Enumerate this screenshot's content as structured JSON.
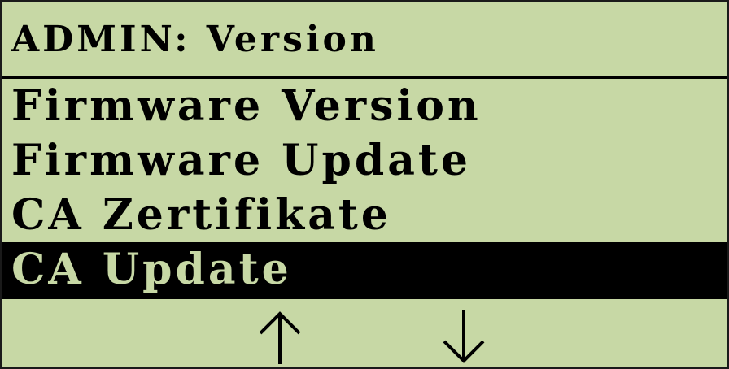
{
  "screen": {
    "title": "ADMIN: Version",
    "background_color": "#c7d8a5",
    "foreground_color": "#000000"
  },
  "menu": {
    "items": [
      {
        "label": "Firmware Version",
        "selected": false
      },
      {
        "label": "Firmware Update",
        "selected": false
      },
      {
        "label": "CA Zertifikate",
        "selected": false
      },
      {
        "label": "CA Update",
        "selected": true
      }
    ]
  },
  "nav": {
    "up_icon": "arrow-up-icon",
    "down_icon": "arrow-down-icon"
  }
}
